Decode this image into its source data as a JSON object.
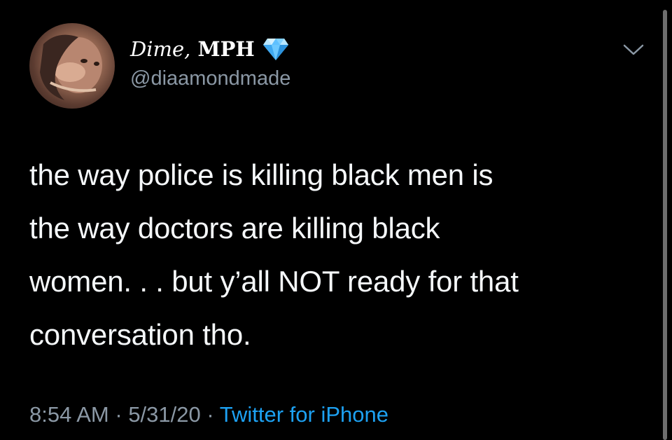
{
  "author": {
    "display_name_script": "Dime,",
    "display_name_rest": "MPH",
    "handle": "@diaamondmade",
    "badge_icon": "diamond-icon"
  },
  "tweet": {
    "lines": [
      "the way police is killing black men is",
      "the way doctors are killing black",
      "women. . . but y’all NOT ready for that",
      "conversation tho."
    ]
  },
  "meta": {
    "time": "8:54 AM",
    "separator1": " · ",
    "date": "5/31/20",
    "separator2": " · ",
    "source": "Twitter for iPhone"
  },
  "colors": {
    "background": "#000000",
    "text": "#f5f8fa",
    "secondary_text": "#8b98a5",
    "link": "#1da1f2",
    "diamond": "#4fb7ff"
  },
  "icons": {
    "menu": "chevron-down-icon"
  }
}
